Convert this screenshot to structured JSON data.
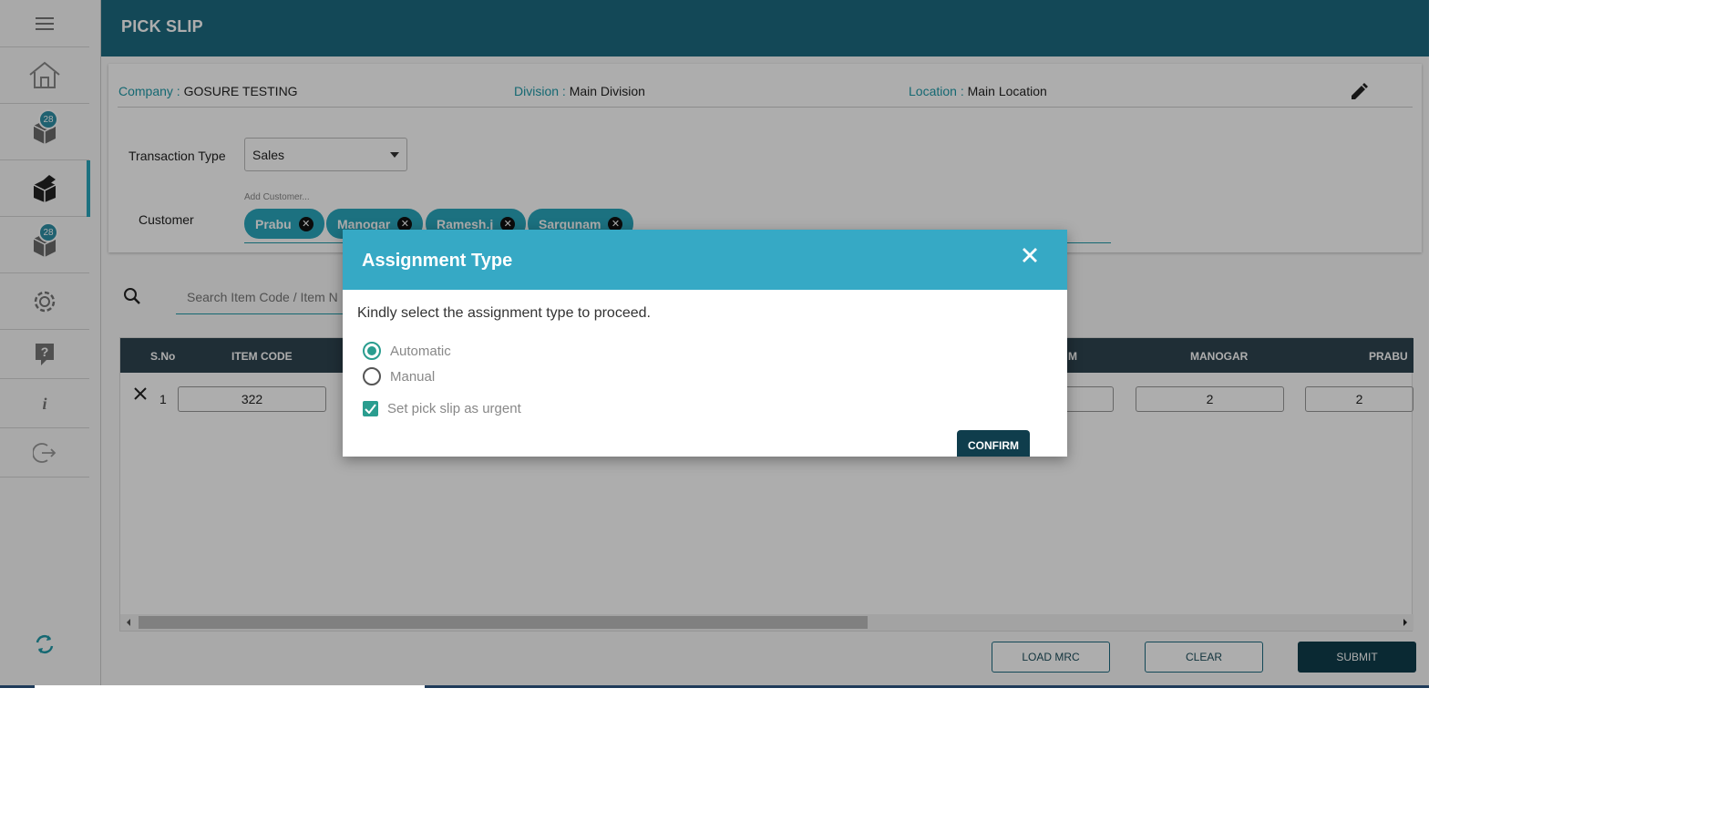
{
  "header": {
    "title": "PICK SLIP"
  },
  "sidebar": {
    "items": [
      {
        "name": "menu",
        "icon": "hamburger-icon"
      },
      {
        "name": "home",
        "icon": "home-icon"
      },
      {
        "name": "orders",
        "icon": "box-icon",
        "badge": "28"
      },
      {
        "name": "pick-slip",
        "icon": "open-box-icon",
        "active": true
      },
      {
        "name": "deliveries",
        "icon": "box-icon",
        "badge": "28"
      },
      {
        "name": "settings",
        "icon": "gear-icon"
      },
      {
        "name": "help",
        "icon": "help-icon"
      },
      {
        "name": "info",
        "icon": "info-icon"
      },
      {
        "name": "logout",
        "icon": "logout-icon"
      },
      {
        "name": "sync",
        "icon": "sync-icon"
      }
    ]
  },
  "info": {
    "company_label": "Company :",
    "company_value": "GOSURE TESTING",
    "division_label": "Division :",
    "division_value": "Main Division",
    "location_label": "Location :",
    "location_value": "Main Location"
  },
  "form": {
    "transaction_type_label": "Transaction Type",
    "transaction_type_value": "Sales",
    "customer_label": "Customer",
    "customer_hint": "Add Customer...",
    "customers": [
      "Prabu",
      "Manogar",
      "Ramesh.j",
      "Sargunam"
    ]
  },
  "search": {
    "placeholder": "Search Item Code / Item N"
  },
  "table": {
    "headers": {
      "sno": "S.No",
      "item_code": "ITEM CODE",
      "partial_m": "M",
      "manogar": "MANOGAR",
      "prabu": "PRABU"
    },
    "row": {
      "sno": "1",
      "item_code": "322",
      "manogar": "2",
      "prabu": "2"
    }
  },
  "footer": {
    "load_mrc": "LOAD MRC",
    "clear": "CLEAR",
    "submit": "SUBMIT"
  },
  "modal": {
    "title": "Assignment Type",
    "message": "Kindly select the assignment type to proceed.",
    "option_automatic": "Automatic",
    "option_manual": "Manual",
    "urgent_label": "Set pick slip as urgent",
    "confirm": "CONFIRM"
  },
  "colors": {
    "header": "#1c6a80",
    "accent": "#2aa7bd",
    "modal_header": "#36a9c5",
    "dark_button": "#0f3d4c"
  }
}
